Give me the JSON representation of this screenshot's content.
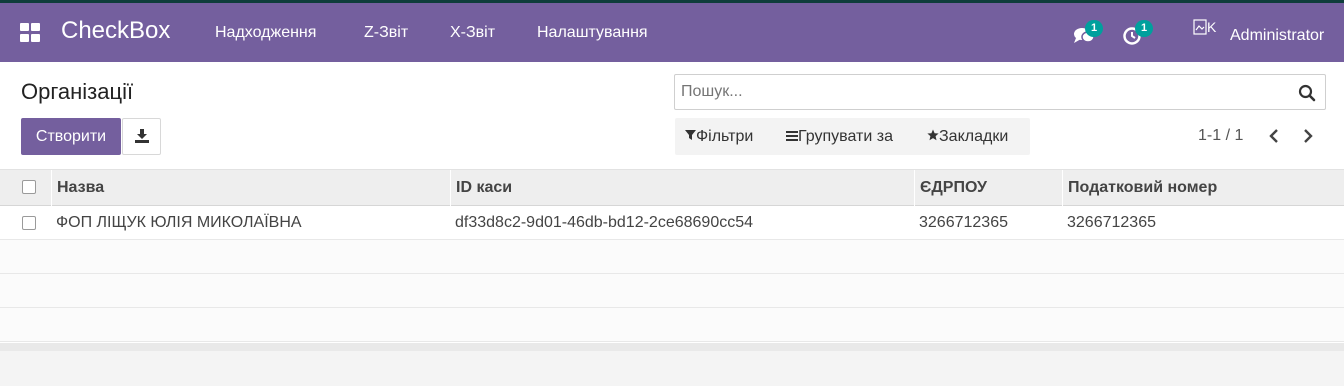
{
  "nav": {
    "brand": "CheckBox",
    "menu": [
      "Надходження",
      "Z-Звіт",
      "X-Звіт",
      "Налаштування"
    ],
    "messages_count": "1",
    "activities_count": "1",
    "avatar_alt": "K",
    "user": "Administrator"
  },
  "control": {
    "title": "Організації",
    "create_label": "Створити",
    "search_placeholder": "Пошук...",
    "filters_label": "Фільтри",
    "group_by_label": "Групувати за",
    "favorites_label": "Закладки",
    "pager": "1-1 / 1"
  },
  "table": {
    "columns": [
      "Назва",
      "ID каси",
      "ЄДРПОУ",
      "Податковий номер"
    ],
    "rows": [
      {
        "name": "ФОП ЛІЩУК ЮЛІЯ МИКОЛАЇВНА",
        "cash_id": "df33d8c2-9d01-46db-bd12-2ce68690cc54",
        "edrpou": "3266712365",
        "tax_number": "3266712365"
      }
    ]
  },
  "colors": {
    "navbar": "#745f9e",
    "primary_button": "#745f9e",
    "badge": "#00a09d"
  }
}
